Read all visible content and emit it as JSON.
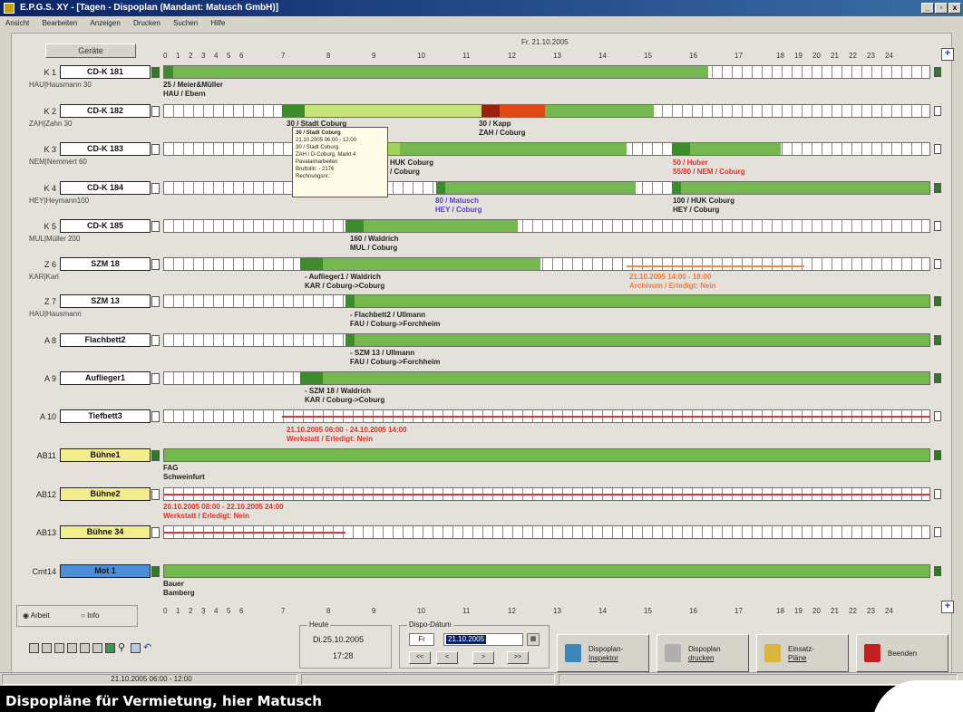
{
  "window": {
    "title": "E.P.G.S. XY - [Tagen - Dispoplan (Mandant: Matusch GmbH)]",
    "controls": [
      "_",
      "▫",
      "x"
    ]
  },
  "menu": [
    "Ansicht",
    "Bearbeiten",
    "Anzeigen",
    "Drucken",
    "Suchen",
    "Hilfe"
  ],
  "header": {
    "devices_label": "Geräte",
    "date": "Fr. 21.10.2005",
    "hours": [
      "0",
      "1",
      "2",
      "3",
      "4",
      "5",
      "6",
      "7",
      "8",
      "9",
      "10",
      "11",
      "12",
      "13",
      "14",
      "15",
      "16",
      "17",
      "18",
      "19",
      "20",
      "21",
      "22",
      "23",
      "24"
    ],
    "add_symbol": "+"
  },
  "rows": [
    {
      "code": "K 1",
      "vehicle": "CD-K 181",
      "driver": "HAU|Hausmann 30",
      "color": "white",
      "end": "green"
    },
    {
      "code": "K 2",
      "vehicle": "CD-K 182",
      "driver": "ZAH|Zahn      30",
      "color": "white",
      "end": "white"
    },
    {
      "code": "K 3",
      "vehicle": "CD-K 183",
      "driver": "NEM|Nemmert 60",
      "color": "white",
      "end": "white"
    },
    {
      "code": "K 4",
      "vehicle": "CD-K 184",
      "driver": "HEY|Heymann100",
      "color": "white",
      "end": "green"
    },
    {
      "code": "K 5",
      "vehicle": "CD-K 185",
      "driver": "MUL|Müller   200",
      "color": "white",
      "end": "white"
    },
    {
      "code": "Z 6",
      "vehicle": "SZM 18",
      "driver": "KAR|Karl",
      "color": "white",
      "end": "white"
    },
    {
      "code": "Z 7",
      "vehicle": "SZM 13",
      "driver": "HAU|Hausmann",
      "color": "white",
      "end": "green"
    },
    {
      "code": "A 8",
      "vehicle": "Flachbett2",
      "driver": "",
      "color": "white",
      "end": "green"
    },
    {
      "code": "A 9",
      "vehicle": "Auflieger1",
      "driver": "",
      "color": "white",
      "end": "green"
    },
    {
      "code": "A 10",
      "vehicle": "Tiefbett3",
      "driver": "",
      "color": "white",
      "end": "white"
    },
    {
      "code": "AB11",
      "vehicle": "Bühne1",
      "driver": "",
      "color": "yellow",
      "end": "green"
    },
    {
      "code": "AB12",
      "vehicle": "Bühne2",
      "driver": "",
      "color": "yellow",
      "end": "white"
    },
    {
      "code": "AB13",
      "vehicle": "Bühne 34",
      "driver": "",
      "color": "yellow",
      "end": "white"
    },
    {
      "code": "Cmt14",
      "vehicle": "Mot 1",
      "driver": "",
      "color": "blue",
      "end": "green"
    }
  ],
  "labels": {
    "k1": [
      "25 / Meier&Müller",
      "HAU / Ebern"
    ],
    "k2a": "30 / Stadt Coburg",
    "k2b": [
      "30 / Kapp",
      "ZAH / Coburg"
    ],
    "k3a": [
      "HUK Coburg",
      "/ Coburg"
    ],
    "k3b": [
      "50 / Huber",
      "55/80 / NEM / Coburg"
    ],
    "k4a": [
      "80 / Matusch",
      "HEY / Coburg"
    ],
    "k4b": [
      "100 / HUK Coburg",
      "HEY / Coburg"
    ],
    "k5": [
      "160 / Waldrich",
      "MUL / Coburg"
    ],
    "z6a": [
      "- Auflieger1 / Waldrich",
      "KAR / Coburg->Coburg"
    ],
    "z6b": [
      "21.10.2005 14:00 - 18:00",
      "Archivum / Erledigt: Nein"
    ],
    "z7": [
      "- Flachbett2 / Ullmann",
      "FAU / Coburg->Forchheim"
    ],
    "a8": [
      "- SZM 13 / Ullmann",
      "FAU / Coburg->Forchheim"
    ],
    "a9": [
      "- SZM 18 / Waldrich",
      "KAR / Coburg->Coburg"
    ],
    "a10": [
      "21.10.2005 06:00 - 24.10.2005 14:00",
      "Werkstatt / Erledigt: Nein"
    ],
    "ab11": [
      "FAG",
      "Schweinfurt"
    ],
    "ab12": [
      "20.10.2005 08:00 - 22.10.2005 24:00",
      "Werkstatt / Erledigt: Nein"
    ],
    "cmt14": [
      "Bauer",
      "Bamberg"
    ]
  },
  "tooltip": [
    "30 / Stadt Coburg",
    "21.10.2005 06:00 - 12:00",
    "30 / Stadt Coburg",
    "ZAH / D-Coburg, Markt 4",
    "Pavalaimarbeiten",
    "Bruttolitr. - 2176",
    "Rechnungsnr.:"
  ],
  "bottom": {
    "radio_arbeit": "Arbeit",
    "radio_info": "Info",
    "heute_title": "Heute",
    "heute_date": "Di.25.10.2005",
    "heute_time": "17:28",
    "dispo_title": "Dispo-Datum",
    "dispo_day": "Fr",
    "dispo_date": "21.10.2005",
    "nav": [
      "<<",
      "<",
      ">",
      ">>"
    ],
    "buttons": [
      {
        "label1": "Dispoplan-",
        "label2": "Inspektor"
      },
      {
        "label1": "Dispoplan",
        "label2": "drucken"
      },
      {
        "label1": "Einsatz-",
        "label2": "Pläne"
      },
      {
        "label1": "Beenden",
        "label2": ""
      }
    ]
  },
  "status": {
    "left": "21.10.2005 06:00 - 12:00",
    "mid": "",
    "right": ""
  },
  "caption": "Dispopläne für Vermietung, hier Matusch",
  "colors": {
    "bar_green": "#74b84e",
    "bar_dark": "#3c8c2c",
    "bar_orange": "#e14a14",
    "red_line": "#e03030",
    "accent_title": "#0a246a"
  }
}
